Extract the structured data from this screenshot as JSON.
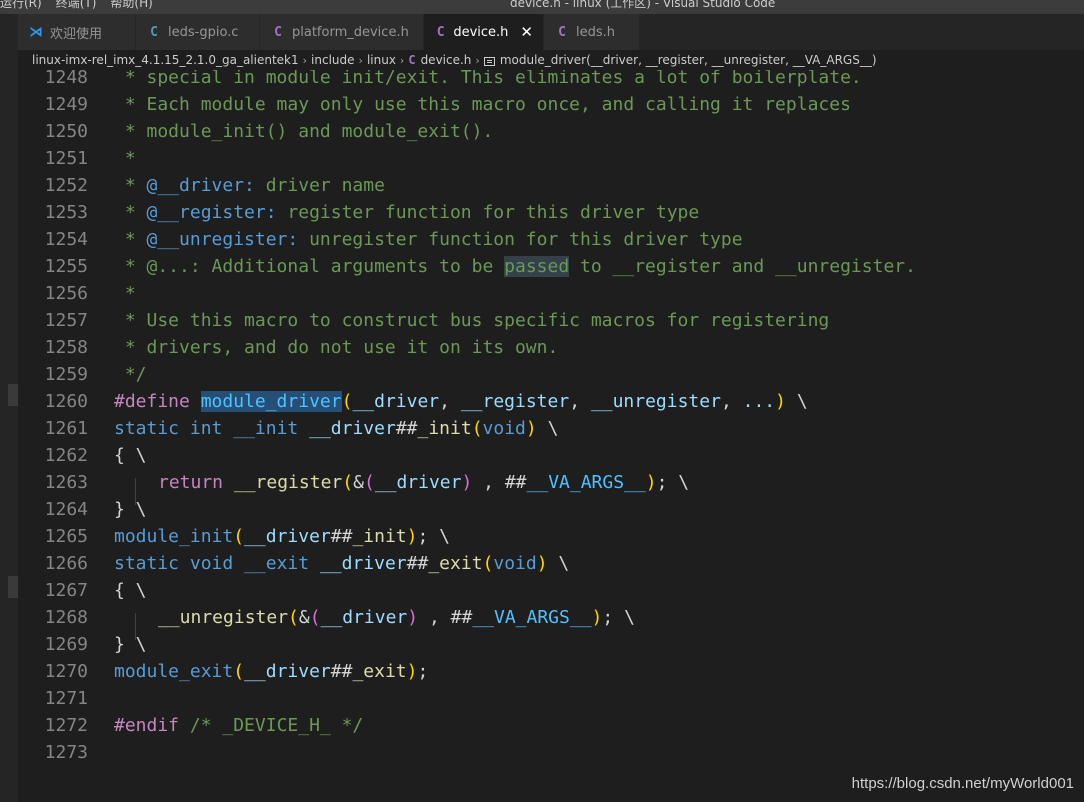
{
  "menubar": {
    "items": [
      "运行(R)",
      "终端(T)",
      "帮助(H)"
    ]
  },
  "window_title": "device.h - linux (工作区) - Visual Studio Code",
  "tabs": [
    {
      "label": "欢迎使用",
      "icon": "vscode-icon",
      "glyph": "⋊"
    },
    {
      "label": "leds-gpio.c",
      "icon": "c-file-icon",
      "glyph": "C"
    },
    {
      "label": "platform_device.h",
      "icon": "c-header-icon",
      "glyph": "C"
    },
    {
      "label": "device.h",
      "icon": "c-header-icon",
      "glyph": "C",
      "close_glyph": "✕"
    },
    {
      "label": "leds.h",
      "icon": "c-header-icon",
      "glyph": "C"
    }
  ],
  "breadcrumb": {
    "segments": [
      "linux-imx-rel_imx_4.1.15_2.1.0_ga_alientek1",
      "include",
      "linux"
    ],
    "file": "device.h",
    "file_glyph": "C",
    "symbol": "module_driver(__driver, __register, __unregister, __VA_ARGS__)",
    "separator": "›"
  },
  "code": {
    "line_numbers": [
      "1248",
      "1249",
      "1250",
      "1251",
      "1252",
      "1253",
      "1254",
      "1255",
      "1256",
      "1257",
      "1258",
      "1259",
      "1260",
      "1261",
      "1262",
      "1263",
      "1264",
      "1265",
      "1266",
      "1267",
      "1268",
      "1269",
      "1270",
      "1271",
      "1272",
      "1273"
    ],
    "l1248": " * special in module init/exit. This eliminates a lot of boilerplate.",
    "l1249": " * Each module may only use this macro once, and calling it replaces",
    "l1250": " * module_init() and module_exit().",
    "l1251": " *",
    "l1252": [
      " * ",
      "@__driver:",
      " driver name"
    ],
    "l1253": [
      " * ",
      "@__register:",
      " register function for this driver type"
    ],
    "l1254": [
      " * ",
      "@__unregister:",
      " unregister function for this driver type"
    ],
    "l1255": [
      " * @...: Additional arguments to be ",
      "passed",
      " to __register and __unregister."
    ],
    "l1256": " *",
    "l1257": " * Use this macro to construct bus specific macros for registering",
    "l1258": " * drivers, and do not use it on its own.",
    "l1259": " */",
    "t": {
      "define": "#define",
      "module_driver": "module_driver",
      "lparen": "(",
      "rparen": ")",
      "p_driver": "__driver",
      "p_register": "__register",
      "p_unregister": "__unregister",
      "comma_sp": ", ",
      "ellipsis": "...",
      "bs": " \\",
      "static": "static",
      "int": "int",
      "void": "void",
      "init_kw": "__init",
      "exit_kw": "__exit",
      "paste": "##",
      "_init": "_init",
      "_exit": "_exit",
      "lbrace": "{",
      "rbrace": "}",
      "return": "return",
      "amp": "&",
      "sp_comma_sp": " , ",
      "va_args": "__VA_ARGS__",
      "semi": ";",
      "module_init": "module_init",
      "module_exit": "module_exit",
      "endif": "#endif",
      "endif_comment": "/* _DEVICE_H_ */",
      "sp": " "
    }
  },
  "watermark": "https://blog.csdn.net/myWorld001"
}
